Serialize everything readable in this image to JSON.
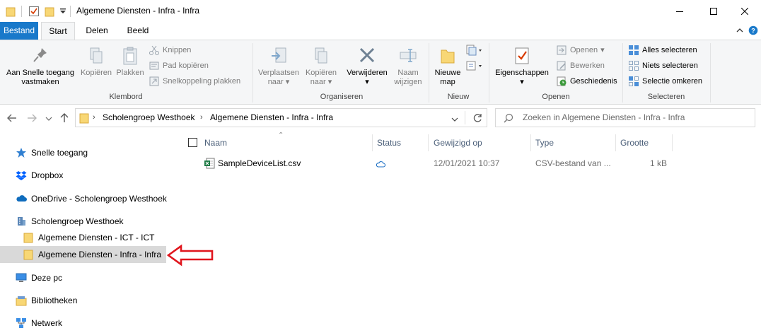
{
  "window": {
    "title": "Algemene Diensten - Infra - Infra"
  },
  "tabs": {
    "bestand": "Bestand",
    "start": "Start",
    "delen": "Delen",
    "beeld": "Beeld"
  },
  "ribbon": {
    "klembord": {
      "label": "Klembord",
      "pin_line1": "Aan Snelle toegang",
      "pin_line2": "vastmaken",
      "copy": "Kopiëren",
      "paste": "Plakken",
      "cut": "Knippen",
      "copy_path": "Pad kopiëren",
      "paste_shortcut": "Snelkoppeling plakken"
    },
    "organiseren": {
      "label": "Organiseren",
      "move_line1": "Verplaatsen",
      "move_line2": "naar",
      "copyto_line1": "Kopiëren",
      "copyto_line2": "naar",
      "delete": "Verwijderen",
      "rename_line1": "Naam",
      "rename_line2": "wijzigen"
    },
    "nieuw": {
      "label": "Nieuw",
      "newfolder_line1": "Nieuwe",
      "newfolder_line2": "map"
    },
    "openen": {
      "label": "Openen",
      "properties": "Eigenschappen",
      "open": "Openen",
      "edit": "Bewerken",
      "history": "Geschiedenis"
    },
    "selecteren": {
      "label": "Selecteren",
      "select_all": "Alles selecteren",
      "select_none": "Niets selecteren",
      "invert": "Selectie omkeren"
    }
  },
  "address": {
    "crumb1": "Scholengroep Westhoek",
    "crumb2": "Algemene Diensten - Infra - Infra",
    "search_placeholder": "Zoeken in Algemene Diensten - Infra - Infra"
  },
  "nav": {
    "quick_access": "Snelle toegang",
    "dropbox": "Dropbox",
    "onedrive": "OneDrive - Scholengroep Westhoek",
    "org": "Scholengroep Westhoek",
    "ict": "Algemene Diensten - ICT - ICT",
    "infra": "Algemene Diensten - Infra - Infra",
    "this_pc": "Deze pc",
    "libraries": "Bibliotheken",
    "network": "Netwerk"
  },
  "columns": {
    "name": "Naam",
    "status": "Status",
    "modified": "Gewijzigd op",
    "type": "Type",
    "size": "Grootte"
  },
  "files": [
    {
      "name": "SampleDeviceList.csv",
      "modified": "12/01/2021 10:37",
      "type": "CSV-bestand van ...",
      "size": "1 kB"
    }
  ],
  "colors": {
    "accent": "#1979ca",
    "selection": "#d9d9d9",
    "annotation_arrow": "#e0161e"
  }
}
